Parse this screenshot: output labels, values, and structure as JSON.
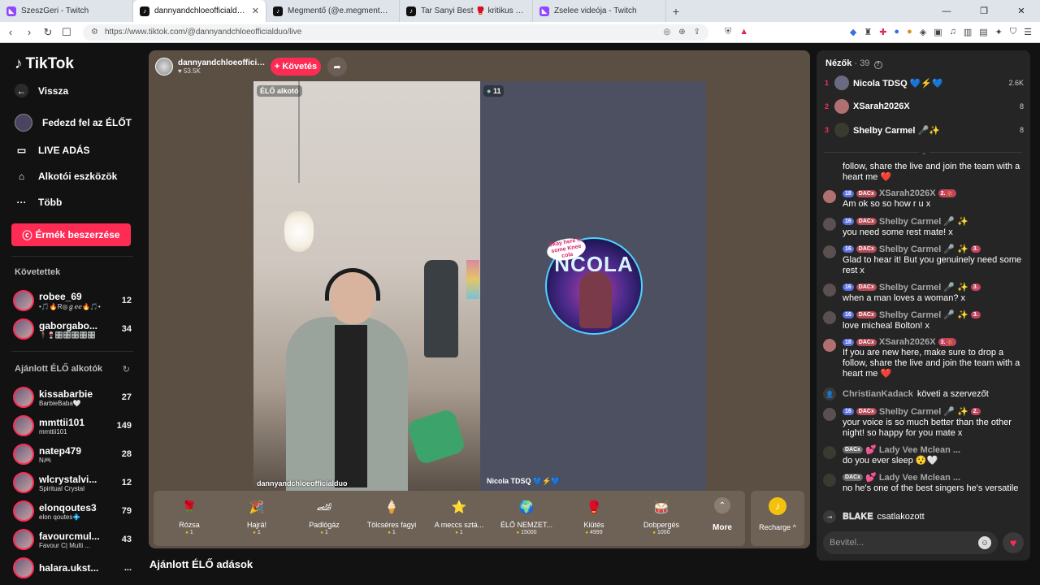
{
  "browser": {
    "tabs": [
      {
        "title": "SzeszGeri - Twitch",
        "favicon": "twitch"
      },
      {
        "title": "dannyandchloeofficialduo (@da",
        "favicon": "tiktok"
      },
      {
        "title": "Megmentő (@e.megmento) ÉLŐ adás",
        "favicon": "tiktok"
      },
      {
        "title": "Tar Sanyi Best 🥊 kritikus 🎒 (@szop",
        "favicon": "tiktok"
      },
      {
        "title": "Zselee videója - Twitch",
        "favicon": "twitch"
      }
    ],
    "new_tab": "+",
    "url": "https://www.tiktok.com/@dannyandchloeofficialduo/live"
  },
  "sidebar": {
    "logo": "TikTok",
    "back": "Vissza",
    "explore_live": "Fedezd fel az ÉLŐT",
    "live_broadcast": "LIVE ADÁS",
    "creator_tools": "Alkotói eszközök",
    "more": "Több",
    "coins_button": "Érmék beszerzése",
    "following_header": "Követettek",
    "following": [
      {
        "name": "robee_69",
        "sub": "•🎵🔥R◎ℊℯℯ🔥🎵•",
        "count": "12"
      },
      {
        "name": "gaborgabo...",
        "sub": "🕴️🍷🎛️🎛️🎛️🎛️🎛️",
        "count": "34"
      }
    ],
    "recommended_header": "Ajánlott ÉLŐ alkotók",
    "recommended": [
      {
        "name": "kissabarbie",
        "sub": "BarbieBaba🤍",
        "count": "27"
      },
      {
        "name": "mmttii101",
        "sub": "mmttii101",
        "count": "149"
      },
      {
        "name": "natep479",
        "sub": "N🎮",
        "count": "28"
      },
      {
        "name": "wlcrystalvi...",
        "sub": "Spiritual Crystal",
        "count": "12"
      },
      {
        "name": "elonqoutes3",
        "sub": "elon qoutes💠",
        "count": "79"
      },
      {
        "name": "favourcmul...",
        "sub": "Favour C| Multi ...",
        "count": "43"
      },
      {
        "name": "halara.ukst...",
        "sub": "",
        "count": "..."
      }
    ]
  },
  "live": {
    "host_name": "dannyandchloeofficiald...",
    "host_likes": "♥ 53.5K",
    "follow_label": "+ Követés",
    "badge_creator": "ÉLŐ alkotó",
    "left_cam_name": "dannyandchloeofficialduo",
    "guest_count": "11",
    "guest_name": "Nicola TDSQ 💙⚡💙",
    "guest_logo_text": "NCOLA",
    "guest_bubble": "Okay here is some Knee cola",
    "gifts": [
      {
        "name": "Rózsa",
        "price": "1",
        "icon": "🌹"
      },
      {
        "name": "Hajrá!",
        "price": "1",
        "icon": "🎉"
      },
      {
        "name": "Padlógáz",
        "price": "1",
        "icon": "🏎"
      },
      {
        "name": "Tölcséres fagyi",
        "price": "1",
        "icon": "🍦"
      },
      {
        "name": "A meccs sztá...",
        "price": "1",
        "icon": "⭐"
      },
      {
        "name": "ÉLŐ NEMZET...",
        "price": "15000",
        "icon": "🌍"
      },
      {
        "name": "Kiütés",
        "price": "4999",
        "icon": "🥊"
      },
      {
        "name": "Dobpergés",
        "price": "1000",
        "icon": "🥁"
      }
    ],
    "more_label": "More",
    "recharge_label": "Recharge ^"
  },
  "recommended_title": "Ajánlott ÉLŐ adások",
  "chat": {
    "viewers_label": "Nézők",
    "viewers_count": "· 39",
    "top_viewers": [
      {
        "rank": "1",
        "name": "Nicola TDSQ 💙⚡💙",
        "score": "2.6K"
      },
      {
        "rank": "2",
        "name": "XSarah2026X",
        "score": "8"
      },
      {
        "rank": "3",
        "name": "Shelby Carmel 🎤✨",
        "score": "8"
      }
    ],
    "partial_message": "follow, share the live and join the team with a heart me ❤️",
    "messages": [
      {
        "level": "18",
        "fan": "DACx",
        "name": "XSarah2026X",
        "extra": "2. ⛹",
        "text": "Am ok so so how r u x"
      },
      {
        "level": "16",
        "fan": "DACx",
        "name": "Shelby Carmel 🎤 ✨",
        "extra": "",
        "text": "you need some rest mate! x"
      },
      {
        "level": "16",
        "fan": "DACx",
        "name": "Shelby Carmel 🎤 ✨",
        "extra": "3.",
        "text": "Glad to hear it! But you genuinely need some rest x"
      },
      {
        "level": "16",
        "fan": "DACx",
        "name": "Shelby Carmel 🎤 ✨",
        "extra": "3.",
        "text": "when a man loves a woman? x"
      },
      {
        "level": "16",
        "fan": "DACx",
        "name": "Shelby Carmel 🎤 ✨",
        "extra": "3.",
        "text": "love micheal Bolton! x"
      },
      {
        "level": "18",
        "fan": "DACx",
        "name": "XSarah2026X",
        "extra": "3. ⛹",
        "text": "If you are new here, make sure to drop a follow, share the live and join the team with a heart me ❤️"
      }
    ],
    "follow_event": {
      "name": "ChristianKadack",
      "text": "követi a szervezőt"
    },
    "messages2": [
      {
        "level": "16",
        "fan": "DACx",
        "name": "Shelby Carmel 🎤 ✨",
        "extra": "2.",
        "text": "your voice is so much better than the other night! so happy for you mate x"
      },
      {
        "level": "",
        "fan": "DACx",
        "name": "💕 Lady Vee Mclean ...",
        "extra": "",
        "text": "do you ever sleep 😯🤍"
      },
      {
        "level": "",
        "fan": "DACx",
        "name": "💕 Lady Vee Mclean ...",
        "extra": "",
        "text": "no he's one of the best singers he's versatile"
      }
    ],
    "join_event": {
      "name": "𝐁𝐋𝐀𝐊𝐄",
      "text": "csatlakozott"
    },
    "input_placeholder": "Bevitel..."
  }
}
